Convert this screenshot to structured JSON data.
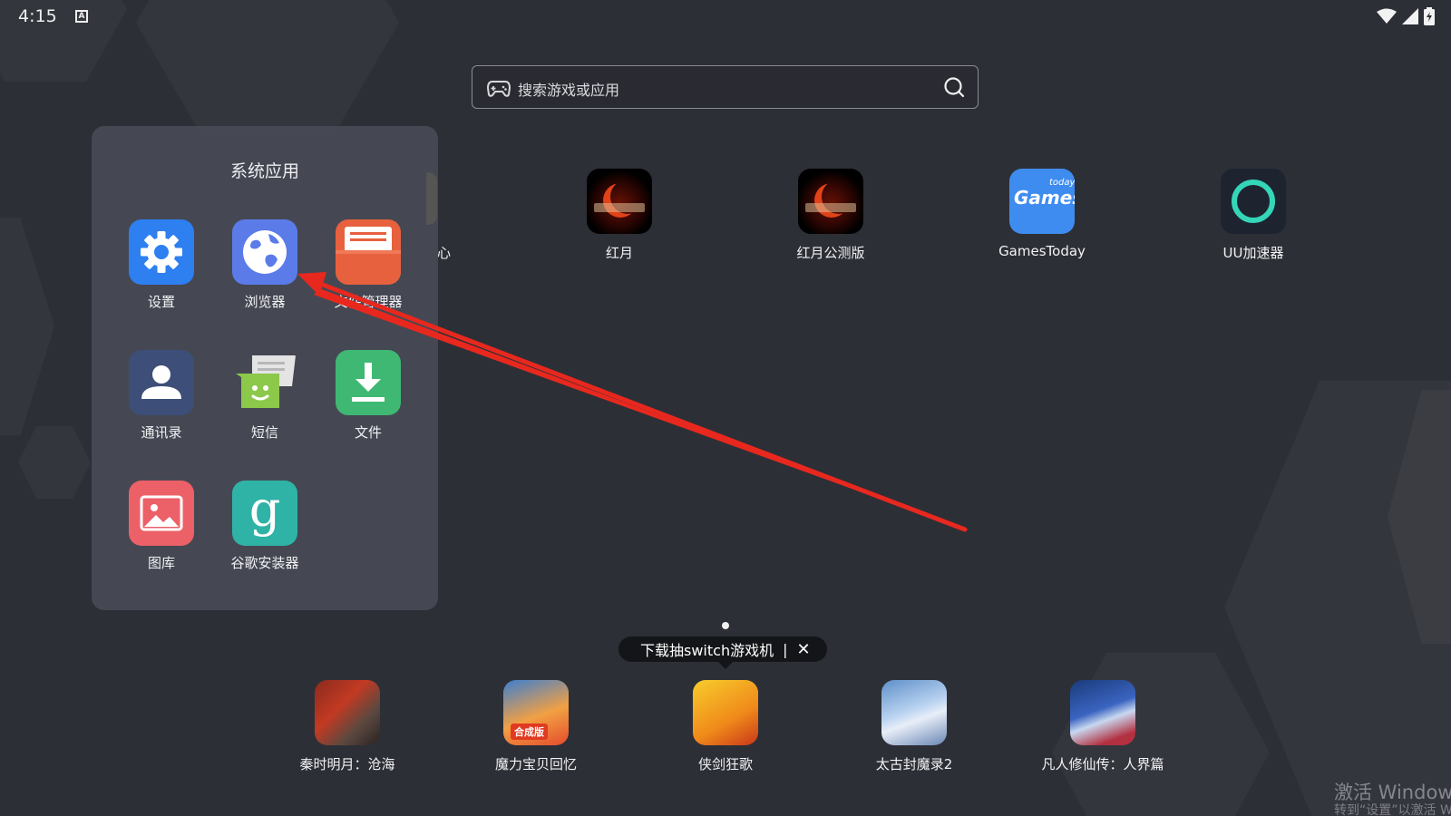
{
  "status_bar": {
    "time": "4:15",
    "indicator": "A",
    "icons": [
      "wifi-icon",
      "signal-icon",
      "battery-icon"
    ]
  },
  "search": {
    "placeholder": "搜索游戏或应用",
    "icons": [
      "gamepad-icon",
      "search-icon"
    ]
  },
  "home_apps": [
    {
      "label": "红月",
      "icon": "red-moon-game-icon"
    },
    {
      "label": "红月公测版",
      "icon": "red-moon-game-icon"
    },
    {
      "label": "GamesToday",
      "icon": "gamestoday-icon",
      "icon_text": "Games",
      "icon_subtext": "today"
    },
    {
      "label": "UU加速器",
      "icon": "uu-accelerator-icon"
    }
  ],
  "partial_app_label": "心",
  "folder": {
    "title": "系统应用",
    "apps": [
      {
        "label": "设置",
        "icon": "settings-gear-icon"
      },
      {
        "label": "浏览器",
        "icon": "browser-globe-icon"
      },
      {
        "label": "文件管理器",
        "icon": "file-manager-icon"
      },
      {
        "label": "通讯录",
        "icon": "contacts-person-icon"
      },
      {
        "label": "短信",
        "icon": "sms-message-icon"
      },
      {
        "label": "文件",
        "icon": "download-file-icon"
      },
      {
        "label": "图库",
        "icon": "gallery-image-icon"
      },
      {
        "label": "谷歌安装器",
        "icon": "google-installer-icon",
        "icon_text": "g"
      }
    ]
  },
  "promo": {
    "text": "下载抽switch游戏机",
    "separator": "|",
    "close": "✕"
  },
  "dock_apps": [
    {
      "label": "秦时明月：沧海",
      "icon": "qin-game-icon"
    },
    {
      "label": "魔力宝贝回忆",
      "icon": "moli-game-icon",
      "badge": "合成版"
    },
    {
      "label": "侠剑狂歌",
      "icon": "xiajian-game-icon"
    },
    {
      "label": "太古封魔录2",
      "icon": "taigu-game-icon"
    },
    {
      "label": "凡人修仙传：人界篇",
      "icon": "fanren-game-icon"
    }
  ],
  "watermark": {
    "line1": "激活 Windows",
    "line2": "转到“设置”以激活 Windows。"
  },
  "colors": {
    "background": "#2d2f36",
    "folder_panel": "#484b56",
    "annotation_arrow": "#e8281e",
    "promo_bg": "#141518"
  }
}
